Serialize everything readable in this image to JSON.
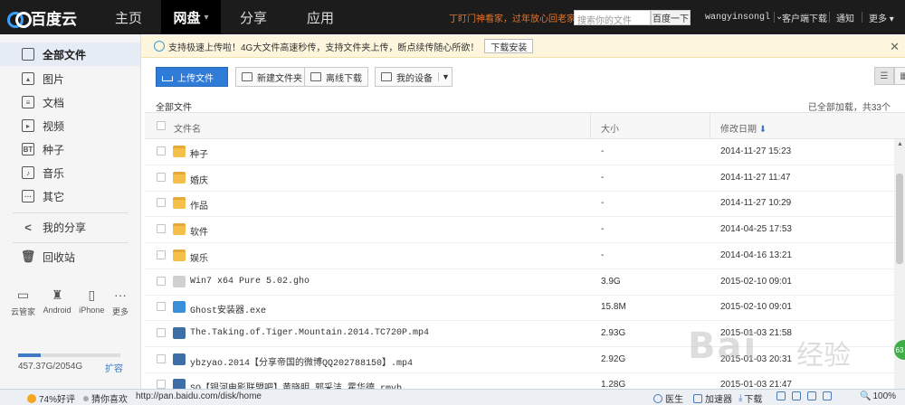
{
  "topbar": {
    "logo": "百度云",
    "nav": [
      {
        "label": "主页"
      },
      {
        "label": "网盘",
        "active": true
      },
      {
        "label": "分享"
      },
      {
        "label": "应用"
      }
    ],
    "promo": "丁盯门神看家，过年放心回老家",
    "search_placeholder": "搜索你的文件",
    "search_button": "百度一下",
    "username": "wangyinsongl",
    "client_download": "客户端下载",
    "notifications": "通知",
    "more": "更多"
  },
  "sidebar": {
    "items": [
      {
        "label": "全部文件",
        "icon": "file-icon",
        "active": true
      },
      {
        "label": "图片",
        "icon": "image-icon"
      },
      {
        "label": "文档",
        "icon": "document-icon"
      },
      {
        "label": "视频",
        "icon": "video-icon"
      },
      {
        "label": "种子",
        "icon": "bt-icon",
        "glyph": "BT"
      },
      {
        "label": "音乐",
        "icon": "music-icon"
      },
      {
        "label": "其它",
        "icon": "other-icon"
      }
    ],
    "share": "我的分享",
    "trash": "回收站",
    "devices": [
      {
        "label": "云管家",
        "icon": "monitor-icon"
      },
      {
        "label": "Android",
        "icon": "android-icon"
      },
      {
        "label": "iPhone",
        "icon": "iphone-icon"
      },
      {
        "label": "更多",
        "icon": "more-dots-icon"
      }
    ],
    "quota": {
      "used": "457.37G",
      "total": "/2054G",
      "fraction": 0.22
    },
    "expand": "扩容"
  },
  "notice": {
    "text": "支持极速上传啦！4G大文件高速秒传，支持文件夹上传，断点续传随心所欲！",
    "button": "下载安装"
  },
  "toolbar": {
    "upload": "上传文件",
    "new_folder": "新建文件夹",
    "offline": "离线下载",
    "devices": "我的设备"
  },
  "breadcrumb": "全部文件",
  "count": "已全部加载，共33个",
  "columns": {
    "name": "文件名",
    "size": "大小",
    "date": "修改日期"
  },
  "files": [
    {
      "name": "种子",
      "type": "folder",
      "size": "-",
      "date": "2014-11-27 15:23"
    },
    {
      "name": "婚庆",
      "type": "folder",
      "size": "-",
      "date": "2014-11-27 11:47"
    },
    {
      "name": "作品",
      "type": "folder",
      "size": "-",
      "date": "2014-11-27 10:29"
    },
    {
      "name": "软件",
      "type": "folder",
      "size": "-",
      "date": "2014-04-25 17:53"
    },
    {
      "name": "娱乐",
      "type": "folder",
      "size": "-",
      "date": "2014-04-16 13:21"
    },
    {
      "name": "Win7 x64 Pure 5.02.gho",
      "type": "ghost",
      "size": "3.9G",
      "date": "2015-02-10 09:01"
    },
    {
      "name": "Ghost安装器.exe",
      "type": "exe",
      "size": "15.8M",
      "date": "2015-02-10 09:01"
    },
    {
      "name": "The.Taking.of.Tiger.Mountain.2014.TC720P.mp4",
      "type": "video",
      "size": "2.93G",
      "date": "2015-01-03 21:58"
    },
    {
      "name": "ybzyao.2014【分享帝国的微博QQ202788150】.mp4",
      "type": "video",
      "size": "2.92G",
      "date": "2015-01-03 20:31"
    },
    {
      "name": "SQ【银河电影联盟吧】黄晓明 郭采洁 霍华德.rmvb",
      "type": "video",
      "size": "1.28G",
      "date": "2015-01-03 21:47"
    }
  ],
  "statusbar": {
    "rating": "74%好评",
    "guess": "猜你喜欢",
    "url": "http://pan.baidu.com/disk/home",
    "doctor": "医生",
    "accelerator": "加速器",
    "download": "下载",
    "zoom": "100%"
  },
  "watermark": {
    "text": "Bai",
    "sub": "经验"
  },
  "badge": "63"
}
